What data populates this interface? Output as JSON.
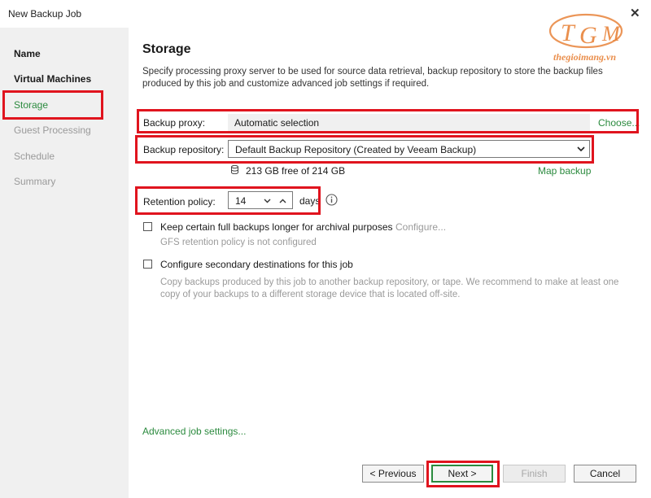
{
  "window": {
    "title": "New Backup Job"
  },
  "logo": {
    "letters": "TGM",
    "site": "thegioimang.vn"
  },
  "sidebar": {
    "items": [
      {
        "label": "Name"
      },
      {
        "label": "Virtual Machines"
      },
      {
        "label": "Storage"
      },
      {
        "label": "Guest Processing"
      },
      {
        "label": "Schedule"
      },
      {
        "label": "Summary"
      }
    ]
  },
  "page": {
    "title": "Storage",
    "description": "Specify processing proxy server to be used for source data retrieval, backup repository to store the backup files produced by this job and customize advanced job settings if required."
  },
  "proxy": {
    "label": "Backup proxy:",
    "value": "Automatic selection",
    "choose": "Choose..."
  },
  "repository": {
    "label": "Backup repository:",
    "value": "Default Backup Repository (Created by Veeam Backup)",
    "free": "213 GB free of 214 GB",
    "map": "Map backup"
  },
  "retention": {
    "label": "Retention policy:",
    "value": "14",
    "unit": "days"
  },
  "gfs": {
    "label": "Keep certain full backups longer for archival purposes",
    "configure": "Configure...",
    "note": "GFS retention policy is not configured"
  },
  "secondary": {
    "label": "Configure secondary destinations for this job",
    "note": "Copy backups produced by this job to another backup repository, or tape. We recommend to make at least one copy of your backups to a different storage device that is located off-site."
  },
  "advanced": {
    "label": "Advanced job settings..."
  },
  "buttons": {
    "previous": "< Previous",
    "next": "Next >",
    "finish": "Finish",
    "cancel": "Cancel"
  },
  "colors": {
    "accent": "#2b8a3e",
    "highlight": "#e0141e",
    "logo": "#e8833a"
  }
}
